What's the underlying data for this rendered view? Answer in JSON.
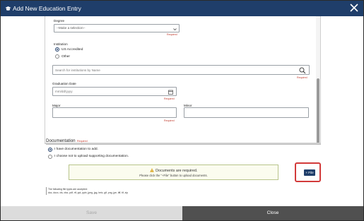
{
  "window": {
    "title": "Add New Education Entry",
    "close_icon": "close-icon",
    "title_icon": "graduation-cap-icon"
  },
  "form": {
    "degree": {
      "label": "Degree",
      "value": "--Make a selection--",
      "required": "Required"
    },
    "institution": {
      "label": "Institution",
      "options": [
        {
          "label": "US Accredited",
          "selected": true
        },
        {
          "label": "Other",
          "selected": false
        }
      ],
      "search_placeholder": "Search for institutions by Name",
      "required": "Required"
    },
    "graduation": {
      "label": "Graduation Date",
      "placeholder": "mm/dd/yyyy",
      "required": "Required"
    },
    "major": {
      "label": "Major",
      "required": "Required"
    },
    "minor": {
      "label": "Minor"
    }
  },
  "documentation": {
    "title": "Documentation",
    "required": "Required",
    "options": [
      {
        "label": "I have documentation to add.",
        "selected": true
      },
      {
        "label": "I choose not to upload supporting documentation.",
        "selected": false
      }
    ],
    "alert_title": "Documents are required.",
    "alert_text": "Please click the \"+File\" button to upload documents.",
    "file_button": "+ File",
    "types_line1": "The following file types are accepted:",
    "types_line2": "doc, docx, xls, xlsx, pdf, rtf, ppt, pptx, jpeg, jpg, heic, gif, png, jpe, tiff, tif, zip"
  },
  "footer": {
    "save": "Save",
    "close": "Close"
  },
  "colors": {
    "titlebar": "#1f3e6a",
    "required": "#c0392b",
    "highlight": "#d23a3a",
    "close_button": "#505050",
    "save_button": "#dcdcdc"
  }
}
